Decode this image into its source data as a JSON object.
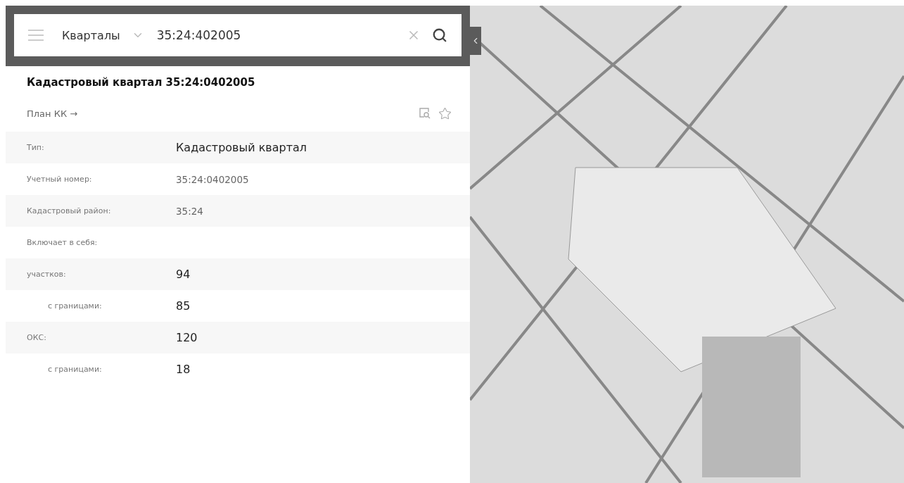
{
  "search": {
    "category": "Кварталы",
    "value": "35:24:402005"
  },
  "title": "Кадастровый квартал 35:24:0402005",
  "plan_link": "План КК →",
  "rows": [
    {
      "label": "Тип:",
      "value": "Кадастровый квартал",
      "kind": "large"
    },
    {
      "label": "Учетный номер:",
      "value": "35:24:0402005",
      "kind": "plain"
    },
    {
      "label": "Кадастровый район:",
      "value": "35:24",
      "kind": "plain"
    },
    {
      "label": "Включает в себя:"
    },
    {
      "label": "участков:",
      "value": "94",
      "kind": "large",
      "children": [
        {
          "label": "с границами:",
          "value": "85",
          "kind": "large"
        }
      ]
    },
    {
      "label": "ОКС:",
      "value": "120",
      "kind": "large",
      "children": [
        {
          "label": "с границами:",
          "value": "18",
          "kind": "large"
        }
      ]
    }
  ]
}
